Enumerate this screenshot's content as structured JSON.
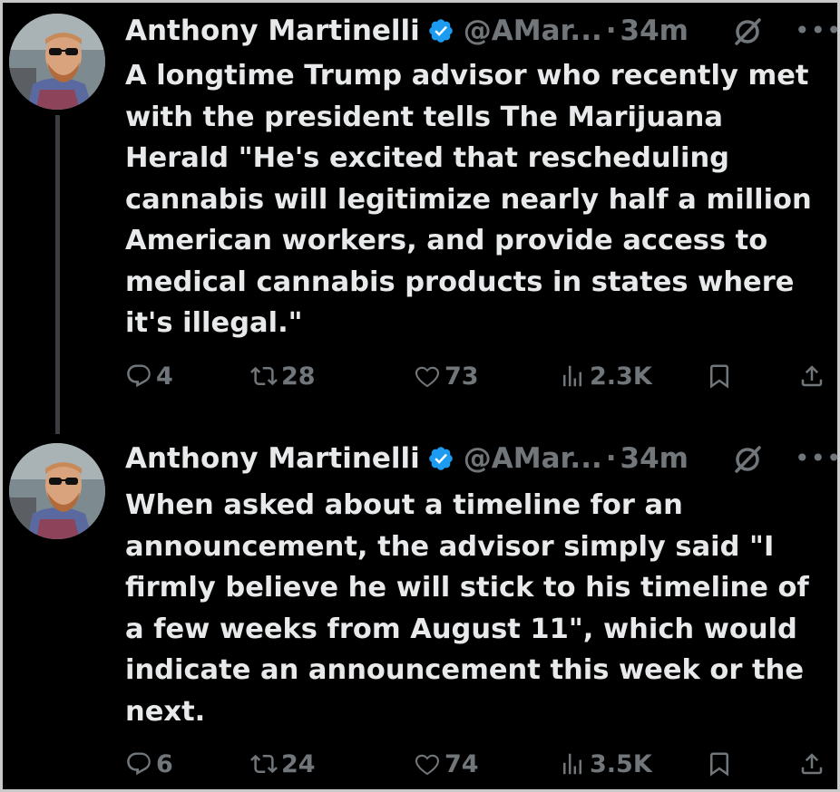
{
  "tweets": [
    {
      "name": "Anthony Martinelli",
      "handle": "@AMar...",
      "dot": "·",
      "time": "34m",
      "text": "A longtime Trump advisor who recently met\nwith the president tells The Marijuana\nHerald \"He's excited that rescheduling\ncannabis will legitimize nearly half a million\nAmerican workers, and provide access to\nmedical cannabis products in states where\nit's illegal.\"",
      "replies": "4",
      "reposts": "28",
      "likes": "73",
      "views": "2.3K"
    },
    {
      "name": "Anthony Martinelli",
      "handle": "@AMar...",
      "dot": "·",
      "time": "34m",
      "text": "When asked about a timeline for an\nannouncement, the advisor simply said \"I\nfirmly believe he will stick to his timeline of\na few weeks from August 11\", which would\nindicate an announcement this week or the\nnext.",
      "replies": "6",
      "reposts": "24",
      "likes": "74",
      "views": "3.5K"
    }
  ],
  "more_glyph": "•••",
  "icons": {
    "verified": "verified-badge-icon",
    "grok": "grok-icon",
    "reply": "reply-icon",
    "repost": "repost-icon",
    "like": "heart-icon",
    "views": "views-icon",
    "bookmark": "bookmark-icon",
    "share": "share-icon"
  },
  "colors": {
    "background": "#000000",
    "text": "#e7e9ea",
    "secondary": "#71767b",
    "verified": "#1d9bf0",
    "thread_line": "#3a3d41"
  }
}
